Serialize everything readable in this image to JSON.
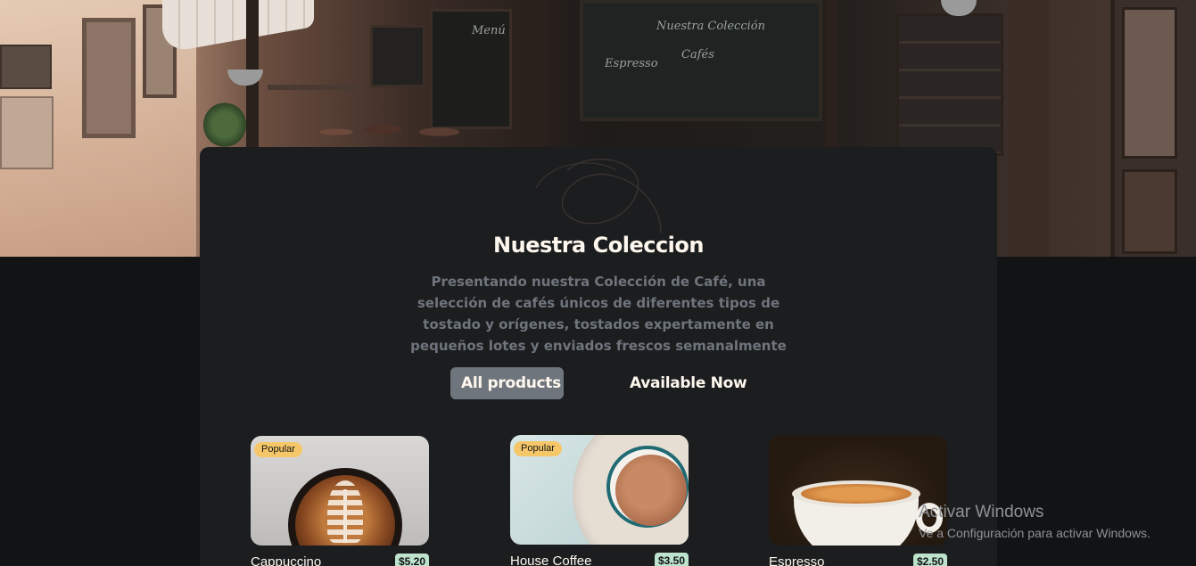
{
  "hero": {
    "chalkboard_lines": [
      "Nuestra Colección",
      "Espresso",
      "Cafés",
      "Menú"
    ]
  },
  "collection": {
    "title": "Nuestra Coleccion",
    "description": "Presentando nuestra Colección de Café, una selección de cafés únicos de diferentes tipos de tostado y orígenes, tostados expertamente en pequeños lotes y enviados frescos semanalmente",
    "tabs": [
      {
        "label": "All products",
        "active": true
      },
      {
        "label": "Available Now",
        "active": false
      }
    ]
  },
  "products": [
    {
      "name": "Cappuccino",
      "price": "$5.20",
      "badge": "Popular",
      "image": "cappuccino-latte-art"
    },
    {
      "name": "House Coffee",
      "price": "$3.50",
      "badge": "Popular",
      "image": "house-coffee-cup"
    },
    {
      "name": "Espresso",
      "price": "$2.50",
      "badge": "",
      "image": "espresso-cup"
    }
  ],
  "watermark": {
    "title": "Activar Windows",
    "subtitle": "Ve a Configuración para activar Windows."
  },
  "colors": {
    "page_bg": "#111315",
    "card_bg": "#1B1D1F",
    "heading": "#FEF7EE",
    "muted_text": "#6F757C",
    "tab_active": "#6F757C",
    "badge": "#F6C768",
    "price_tag": "#BEE3CC"
  }
}
